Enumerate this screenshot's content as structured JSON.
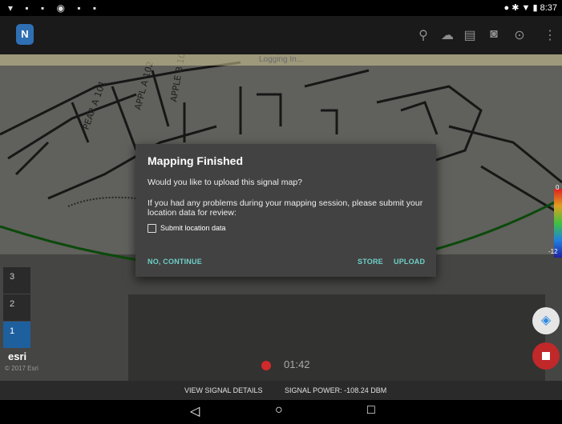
{
  "status_bar": {
    "time": "8:37"
  },
  "map": {
    "banner": "Logging In...",
    "levels": [
      "3",
      "2",
      "1"
    ],
    "attribution": "esri",
    "copyright": "© 2017 Esri",
    "timer": "01:42",
    "legend_top": "0",
    "legend_bottom": "-12"
  },
  "dialog": {
    "title": "Mapping Finished",
    "question": "Would you like to upload this signal map?",
    "problem_text": "If you had any problems during your mapping session, please submit your location data for review:",
    "checkbox_label": "Submit location data",
    "no_continue": "NO, CONTINUE",
    "store": "STORE",
    "upload": "UPLOAD"
  },
  "bottom_bar": {
    "view_details": "VIEW SIGNAL DETAILS",
    "signal_power": "SIGNAL POWER: -108.24 DBM"
  },
  "icons": [
    "search-icon",
    "cloud-upload-icon",
    "file-icon",
    "camera-icon",
    "location-pin-icon",
    "more-vert-icon",
    "back-icon",
    "home-icon",
    "recents-icon",
    "gps-target-icon",
    "stop-icon"
  ]
}
